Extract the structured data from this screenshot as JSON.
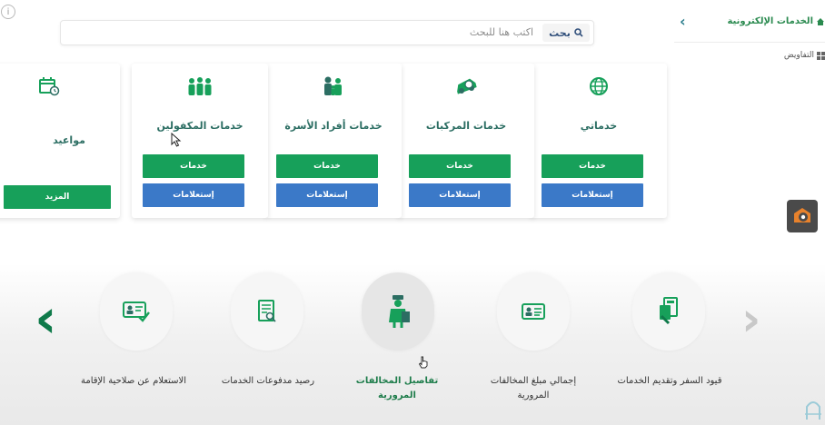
{
  "search": {
    "button_label": "بحث",
    "placeholder": "اكتب هنا للبحث"
  },
  "sidebar": {
    "back_icon": "chevron-left-icon",
    "title": "الخدمات الإلكترونية",
    "items": [
      {
        "label": "التفاويض"
      }
    ]
  },
  "cards": [
    {
      "title": "خدماتي",
      "icon": "globe-icon",
      "primary_label": "خدمات",
      "secondary_label": "إستعلامات"
    },
    {
      "title": "خدمات المركبات",
      "icon": "car-icon",
      "primary_label": "خدمات",
      "secondary_label": "إستعلامات"
    },
    {
      "title": "خدمات أفراد الأسرة",
      "icon": "family-icon",
      "primary_label": "خدمات",
      "secondary_label": "إستعلامات"
    },
    {
      "title": "خدمات المكفولين",
      "icon": "workers-icon",
      "primary_label": "خدمات",
      "secondary_label": "إستعلامات"
    },
    {
      "title": "مواعيد",
      "icon": "calendar-icon",
      "more_label": "المزيد"
    }
  ],
  "services": [
    {
      "label": "قيود السفر وتقديم الخدمات",
      "icon": "travel-document-icon"
    },
    {
      "label": "إجمالي مبلغ المخالفات المرورية",
      "icon": "id-card-icon"
    },
    {
      "label": "تفاصيل المخالفات المرورية",
      "icon": "traffic-officer-icon"
    },
    {
      "label": "رصيد مدفوعات الخدمات",
      "icon": "receipt-icon"
    },
    {
      "label": "الاستعلام عن صلاحية الإقامة",
      "icon": "id-card-check-icon"
    }
  ],
  "colors": {
    "green": "#17a05a",
    "blue": "#3b79c8",
    "teal": "#2c6e63",
    "title_green": "#2a8a4f"
  }
}
